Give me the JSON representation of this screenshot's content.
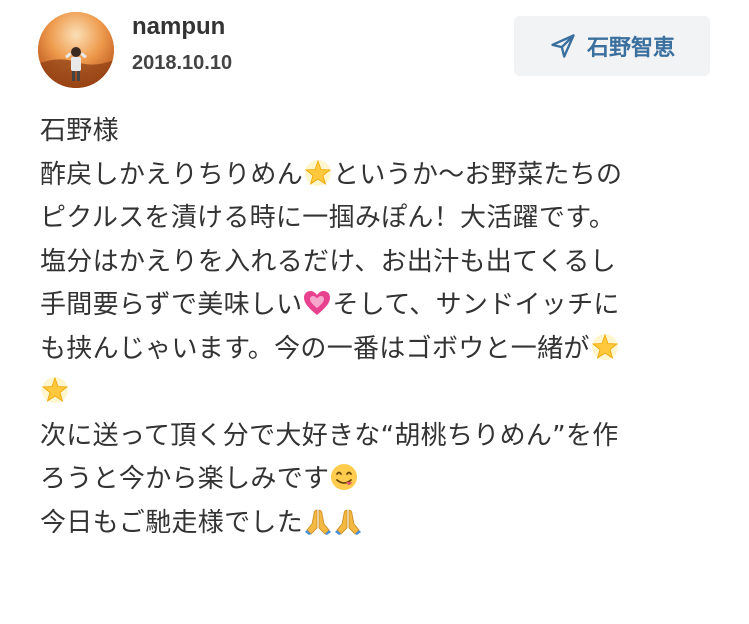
{
  "post": {
    "username": "nampun",
    "date": "2018.10.10",
    "recipient_label": "石野智恵",
    "send_icon": "paper-plane-icon",
    "accent_color": "#3a6f9e",
    "button_bg": "#f2f3f5"
  },
  "message": {
    "lines": [
      [
        "石野様"
      ],
      [
        "酢戻しかえりちりめん",
        "というか〜お野菜たちの"
      ],
      [
        "ピクルスを漬ける時に一掴みぽん！大活躍です。"
      ],
      [
        "塩分はかえりを入れるだけ、お出汁も出てくるし"
      ],
      [
        "手間要らずで美味しい",
        "そして、サンドイッチに"
      ],
      [
        "も挟んじゃいます。今の一番はゴボウと一緒が"
      ],
      [
        ""
      ],
      [
        "次に送って頂く分で大好きな“胡桃ちりめん”を作"
      ],
      [
        "ろうと今から楽しみです"
      ],
      [
        "今日もご馳走様でした"
      ]
    ],
    "emojis": {
      "star": "glowing-star-icon",
      "heart": "growing-heart-icon",
      "smile": "savoring-food-face-icon",
      "pray": "folded-hands-icon"
    }
  }
}
